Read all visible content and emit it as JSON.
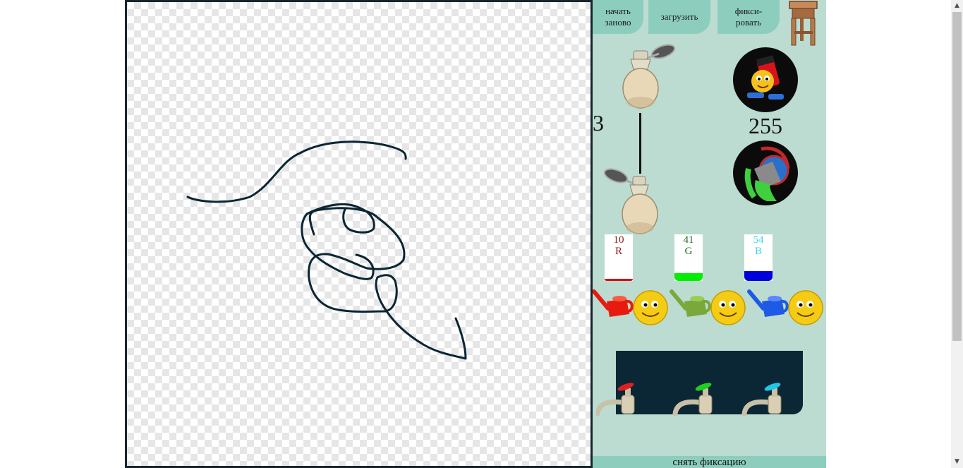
{
  "toolbar": {
    "restart_label_line1": "начать",
    "restart_label_line2": "заново",
    "load_label": "загрузить",
    "fix_label_line1": "фикси-",
    "fix_label_line2": "ровать",
    "stool_icon": "stool-icon"
  },
  "brush": {
    "size_value": "3",
    "top_icon": "perfume-bottle-icon",
    "bottom_icon": "perfume-bottle-icon"
  },
  "opacity": {
    "value": "255",
    "top_icon": "cartoon-marker-icon",
    "bottom_icon": "paint-bucket-icon"
  },
  "color": {
    "r": {
      "value": "10",
      "label": "R",
      "text_color": "#8b1a1a",
      "bar_color": "#e00000",
      "level": 0.04
    },
    "g": {
      "value": "41",
      "label": "G",
      "text_color": "#1e6b1e",
      "bar_color": "#00ee00",
      "level": 0.16
    },
    "b": {
      "value": "54",
      "label": "B",
      "text_color": "#3cd6ee",
      "bar_color": "#0000dd",
      "level": 0.21
    }
  },
  "watering_cans": [
    "red-watering-can-icon",
    "green-watering-can-icon",
    "blue-watering-can-icon"
  ],
  "faucets": [
    "red-faucet-icon",
    "green-faucet-icon",
    "blue-faucet-icon"
  ],
  "bottom": {
    "unfix_label": "снять фиксацию"
  },
  "colors": {
    "panel": "#bcdcd1",
    "tab": "#8ccdbe",
    "stroke": "#0b2634"
  }
}
